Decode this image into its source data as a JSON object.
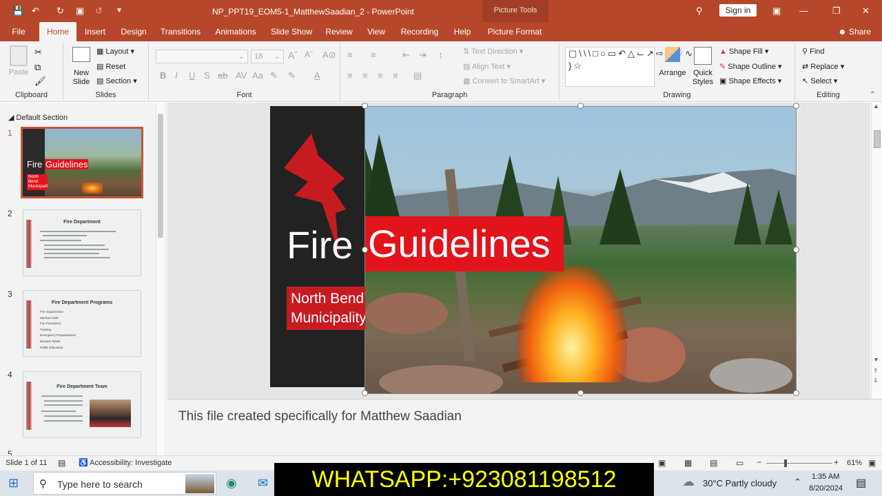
{
  "window": {
    "title": "NP_PPT19_EOM5-1_MatthewSaadian_2  -  PowerPoint",
    "context_tab": "Picture Tools",
    "sign_in": "Sign in"
  },
  "tabs": [
    "File",
    "Home",
    "Insert",
    "Design",
    "Transitions",
    "Animations",
    "Slide Show",
    "Review",
    "View",
    "Recording",
    "Help",
    "Picture Format"
  ],
  "share": "Share",
  "ribbon": {
    "clipboard": {
      "label": "Clipboard",
      "paste": "Paste"
    },
    "slides": {
      "label": "Slides",
      "new_slide_1": "New",
      "new_slide_2": "Slide",
      "layout": "Layout",
      "reset": "Reset",
      "section": "Section"
    },
    "font": {
      "label": "Font",
      "size": "18"
    },
    "paragraph": {
      "label": "Paragraph",
      "text_direction": "Text Direction",
      "align_text": "Align Text",
      "convert": "Convert to SmartArt"
    },
    "drawing": {
      "label": "Drawing",
      "arrange": "Arrange",
      "quick_styles_1": "Quick",
      "quick_styles_2": "Styles",
      "shape_fill": "Shape Fill",
      "shape_outline": "Shape Outline",
      "shape_effects": "Shape Effects"
    },
    "editing": {
      "label": "Editing",
      "find": "Find",
      "replace": "Replace",
      "select": "Select"
    }
  },
  "panel": {
    "section": "Default Section",
    "slides": [
      {
        "num": "1",
        "title": "Fire Guidelines",
        "sub": "North Bend Municipality"
      },
      {
        "num": "2",
        "title": "Fire Department"
      },
      {
        "num": "3",
        "title": "Fire Department Programs",
        "items": [
          "Fire Suppression",
          "Medical Calls",
          "Fire Prevention",
          "Training",
          "Emergency Preparedness",
          "Disaster Relief",
          "Public Education"
        ]
      },
      {
        "num": "4",
        "title": "Fire Department Team"
      },
      {
        "num": "5"
      }
    ]
  },
  "slide": {
    "title_part1": "Fire",
    "title_part2": "Guidelines",
    "subtitle_line1": "North Bend",
    "subtitle_line2": "Municipality",
    "accent": "#e3131b"
  },
  "notes": "This file created specifically for Matthew Saadian",
  "status": {
    "slide_counter": "Slide 1 of 11",
    "accessibility": "Accessibility: Investigate",
    "zoom": "61%"
  },
  "taskbar": {
    "search": "Type here to search",
    "weather": "30°C  Partly cloudy",
    "time": "1:35 AM",
    "date": "8/20/2024"
  },
  "overlay": "WHATSAPP:+923081198512"
}
